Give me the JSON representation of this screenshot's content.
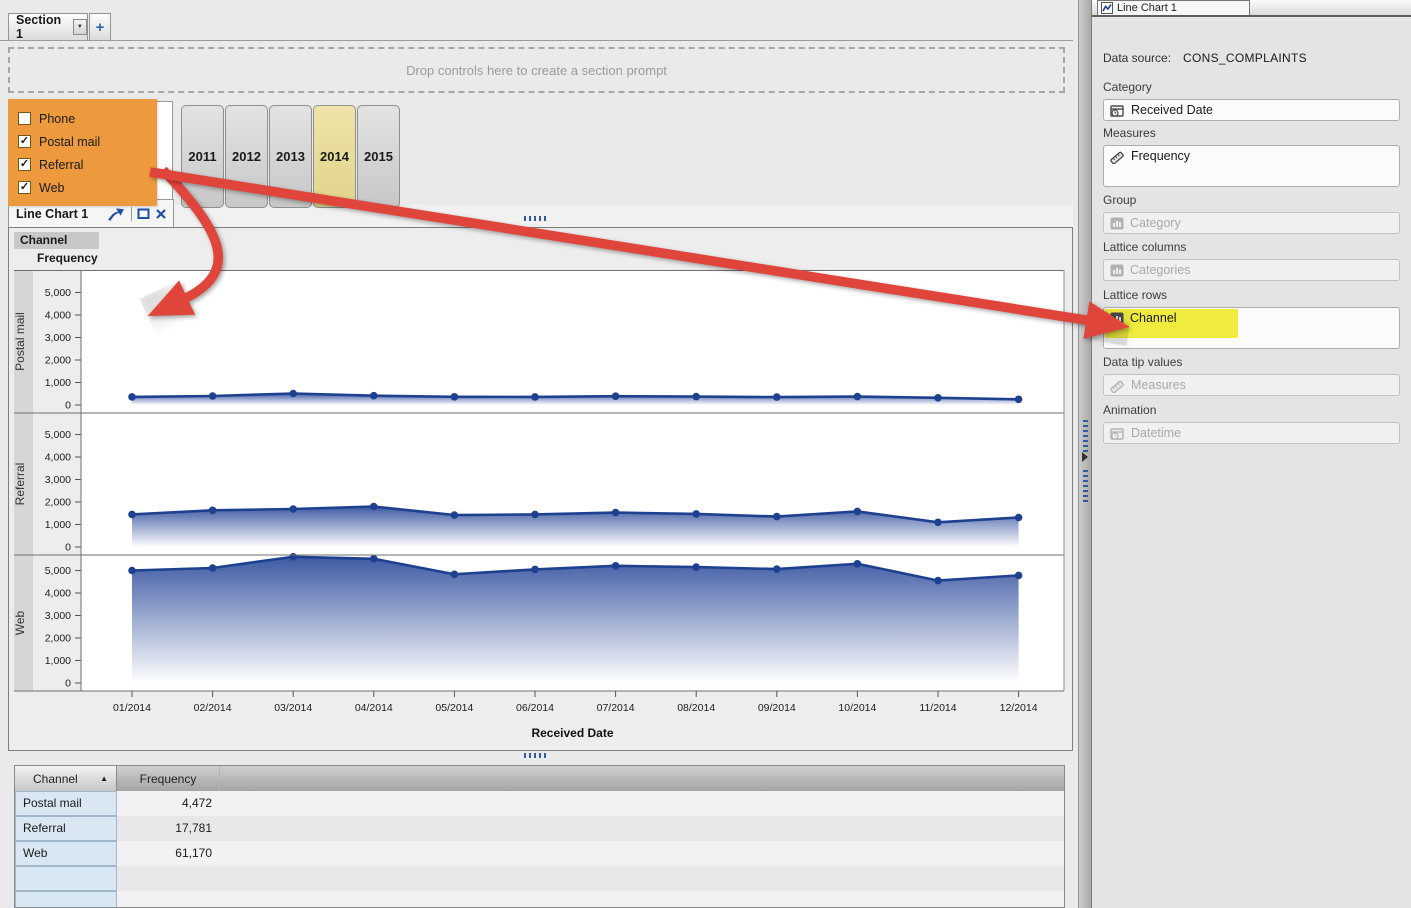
{
  "tabs": {
    "section_label": "Section 1",
    "add_label": "+"
  },
  "prompt_bar": {
    "text": "Drop controls here to create a section prompt"
  },
  "channel_filter": {
    "items": [
      {
        "label": "Phone",
        "checked": false
      },
      {
        "label": "Postal mail",
        "checked": true
      },
      {
        "label": "Referral",
        "checked": true
      },
      {
        "label": "Web",
        "checked": true
      }
    ]
  },
  "year_filter": {
    "options": [
      "2011",
      "2012",
      "2013",
      "2014",
      "2015"
    ],
    "selected": "2014"
  },
  "chart_window": {
    "title": "Line Chart 1",
    "corner_tab": "Channel",
    "measure_label": "Frequency",
    "x_axis_title": "Received Date"
  },
  "chart_data": {
    "type": "line",
    "title": "Channel",
    "ylabel": "Frequency",
    "xlabel": "Received Date",
    "lattice_rows": [
      "Postal mail",
      "Referral",
      "Web"
    ],
    "x": [
      "01/2014",
      "02/2014",
      "03/2014",
      "04/2014",
      "05/2014",
      "06/2014",
      "07/2014",
      "08/2014",
      "09/2014",
      "10/2014",
      "11/2014",
      "12/2014"
    ],
    "series": [
      {
        "name": "Postal mail",
        "values": [
          360,
          400,
          510,
          415,
          365,
          360,
          390,
          375,
          350,
          375,
          320,
          252
        ]
      },
      {
        "name": "Referral",
        "values": [
          1450,
          1630,
          1690,
          1800,
          1420,
          1450,
          1530,
          1470,
          1350,
          1580,
          1100,
          1311
        ]
      },
      {
        "name": "Web",
        "values": [
          5000,
          5110,
          5610,
          5520,
          4830,
          5050,
          5210,
          5150,
          5060,
          5300,
          4550,
          4780
        ]
      }
    ],
    "ylim": [
      0,
      5800
    ],
    "yticks": [
      0,
      1000,
      2000,
      3000,
      4000,
      5000
    ],
    "grid": false,
    "legend": "none"
  },
  "summary_table": {
    "columns": [
      "Channel",
      "Frequency"
    ],
    "sort_column": "Channel",
    "sort_direction": "asc",
    "sort_glyph": "▲",
    "rows": [
      {
        "channel": "Postal mail",
        "frequency": "4,472"
      },
      {
        "channel": "Referral",
        "frequency": "17,781"
      },
      {
        "channel": "Web",
        "frequency": "61,170"
      }
    ]
  },
  "properties_panel": {
    "tab_title": "Line Chart 1",
    "data_source_label": "Data source:",
    "data_source_value": "CONS_COMPLAINTS",
    "sections": [
      {
        "label": "Category",
        "field": "Received Date",
        "icon": "datetime-icon",
        "enabled": true,
        "tall": false,
        "highlight": false
      },
      {
        "label": "Measures",
        "field": "Frequency",
        "icon": "measure-icon",
        "enabled": true,
        "tall": true,
        "highlight": false
      },
      {
        "label": "Group",
        "field": "Category",
        "icon": "category-icon",
        "enabled": false,
        "tall": false,
        "highlight": false
      },
      {
        "label": "Lattice columns",
        "field": "Categories",
        "icon": "category-icon",
        "enabled": false,
        "tall": false,
        "highlight": false
      },
      {
        "label": "Lattice rows",
        "field": "Channel",
        "icon": "category-icon",
        "enabled": true,
        "tall": true,
        "highlight": true
      },
      {
        "label": "Data tip values",
        "field": "Measures",
        "icon": "measure-icon",
        "enabled": false,
        "tall": false,
        "highlight": false
      },
      {
        "label": "Animation",
        "field": "Datetime",
        "icon": "datetime-icon",
        "enabled": false,
        "tall": false,
        "highlight": false
      }
    ]
  },
  "annotations": {
    "highlight_orange": "#EC9A3D",
    "highlight_yellow": "#F0EC3E",
    "arrow_red": "#E0453C"
  },
  "colors": {
    "line_blue": "#1E418F",
    "area_top": "#2E4C9C",
    "year_selected": "#EFE3A8",
    "table_channel_cell": "#D9E7F3",
    "dropdown_check": "#1a1a1a"
  }
}
